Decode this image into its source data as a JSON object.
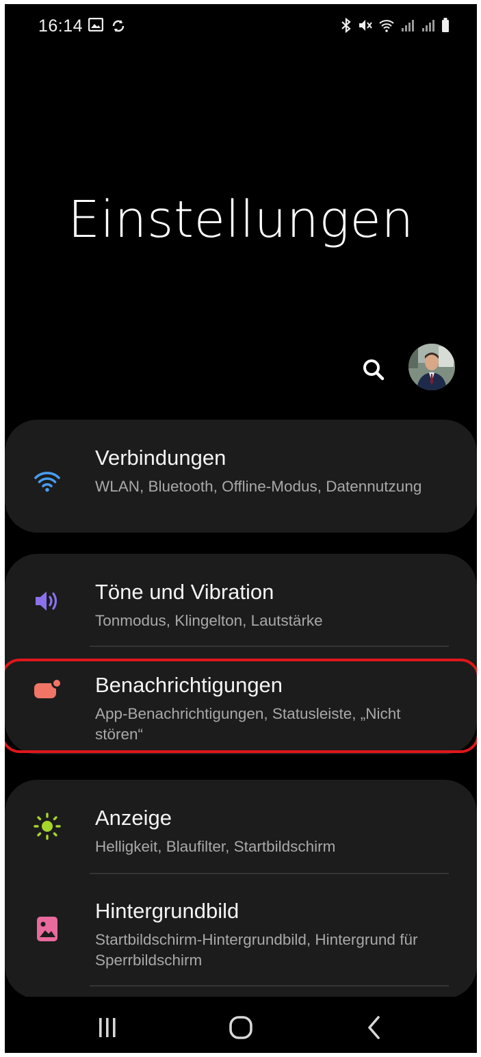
{
  "status_bar": {
    "time": "16:14",
    "left_icons": [
      "gallery-icon",
      "sync-icon"
    ],
    "right_icons": [
      "bluetooth-icon",
      "mute-icon",
      "wifi-icon",
      "signal-icon",
      "signal-icon",
      "battery-icon"
    ]
  },
  "page": {
    "title": "Einstellungen"
  },
  "header_actions": {
    "search_icon": "search-icon",
    "avatar": "profile-avatar"
  },
  "settings": [
    {
      "title": "Verbindungen",
      "subtitle": "WLAN, Bluetooth, Offline-Modus, Datennutzung",
      "icon": "wifi-icon",
      "color": "#4a9cf0"
    },
    {
      "title": "Töne und Vibration",
      "subtitle": "Tonmodus, Klingelton, Lautstärke",
      "icon": "volume-icon",
      "color": "#8b72ec"
    },
    {
      "title": "Benachrichtigungen",
      "subtitle": "App-Benachrichtigungen, Statusleiste, „Nicht stören“",
      "icon": "notification-icon",
      "color": "#f07567",
      "highlighted": true
    },
    {
      "title": "Anzeige",
      "subtitle": "Helligkeit, Blaufilter, Startbildschirm",
      "icon": "brightness-icon",
      "color": "#a7d62b"
    },
    {
      "title": "Hintergrundbild",
      "subtitle": "Startbildschirm-Hintergrundbild, Hintergrund für Sperrbildschirm",
      "icon": "wallpaper-icon",
      "color": "#e96a9c"
    }
  ],
  "nav_bar": [
    "recent-apps-icon",
    "home-icon",
    "back-icon"
  ],
  "colors": {
    "background": "#000000",
    "card": "#1c1c1c",
    "highlight": "#e0161b"
  }
}
